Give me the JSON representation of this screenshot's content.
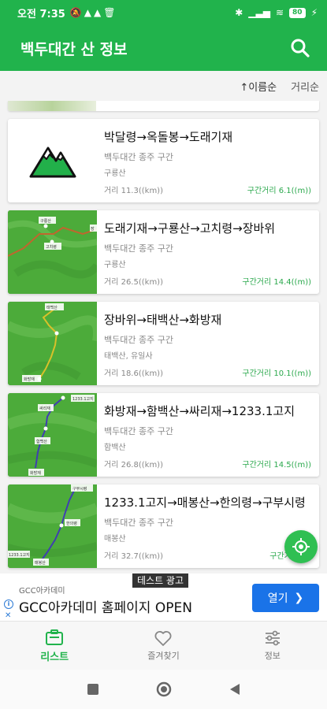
{
  "status_bar": {
    "time": "오전 7:35",
    "left_icons": [
      "mute-icon",
      "warning-icon",
      "alert-icon",
      "trash-icon"
    ],
    "right_icons": [
      "bluetooth-icon",
      "signal-icon",
      "wifi-icon"
    ],
    "battery": "80"
  },
  "app_bar": {
    "title": "백두대간 산 정보",
    "search_icon": "search-icon"
  },
  "sort": {
    "name": "↑이름순",
    "distance": "거리순"
  },
  "colors": {
    "brand": "#21b34c",
    "segment_text": "#2aa84c",
    "ad_button": "#1a73e8"
  },
  "cards": [
    {
      "title": "박달령→옥돌봉→도래기재",
      "subtitle": "백두대간 종주 구간",
      "mountains": "구룡산",
      "distance": "거리 11.3((km))",
      "segment": "구간거리 6.1((m))",
      "thumb": "mountain-icon"
    },
    {
      "title": "도래기재→구룡산→고치령→장바위",
      "subtitle": "백두대간 종주 구간",
      "mountains": "구룡산",
      "distance": "거리 26.5((km))",
      "segment": "구간거리 14.4((m))",
      "thumb": "map",
      "map_labels": [
        "구룡산",
        "고치령",
        "장"
      ]
    },
    {
      "title": "장바위→태백산→화방재",
      "subtitle": "백두대간 종주 구간",
      "mountains": "태백산, 유일사",
      "distance": "거리 18.6((km))",
      "segment": "구간거리 10.1((m))",
      "thumb": "map",
      "map_labels": [
        "태백산",
        "화방재"
      ]
    },
    {
      "title": "화방재→함백산→싸리재→1233.1고지",
      "subtitle": "백두대간 종주 구간",
      "mountains": "함백산",
      "distance": "거리 26.8((km))",
      "segment": "구간거리 14.5((m))",
      "thumb": "map",
      "map_labels": [
        "1233.1고지",
        "싸리재",
        "함백산",
        "화방재"
      ]
    },
    {
      "title": "1233.1고지→매봉산→한의령→구부시령",
      "subtitle": "백두대간 종주 구간",
      "mountains": "매봉산",
      "distance": "거리 32.7((km))",
      "segment": "구간거리 17",
      "thumb": "map",
      "map_labels": [
        "구부시령",
        "한의령",
        "1233.1고지",
        "매봉산"
      ]
    }
  ],
  "ad": {
    "label": "테스트 광고",
    "advertiser": "GCC아카데미",
    "headline": "GCC아카데미 홈페이지 OPEN",
    "button": "열기"
  },
  "bottom_nav": [
    {
      "label": "리스트",
      "icon": "list-icon",
      "active": true
    },
    {
      "label": "즐겨찾기",
      "icon": "heart-icon",
      "active": false
    },
    {
      "label": "정보",
      "icon": "settings-sliders-icon",
      "active": false
    }
  ],
  "system_nav": [
    "recents-icon",
    "home-icon",
    "back-icon"
  ]
}
